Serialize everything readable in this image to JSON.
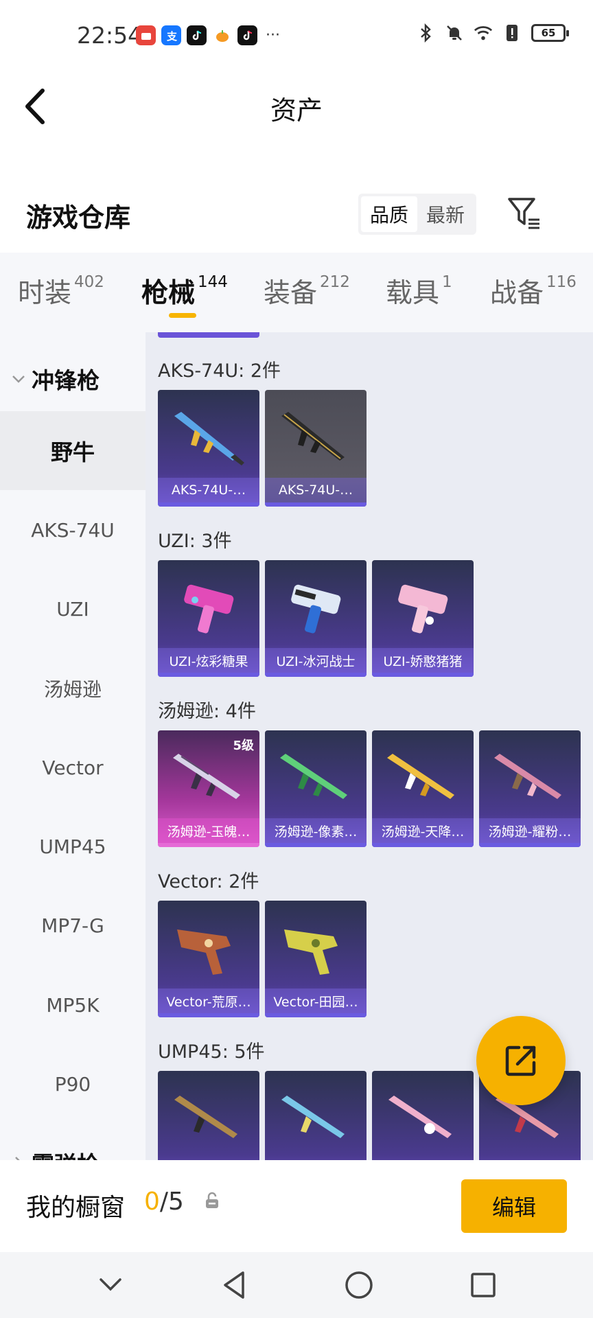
{
  "status_bar": {
    "time": "22:54",
    "battery": "65",
    "app_icons": [
      "huawei-mall-icon",
      "alipay-icon",
      "douyin-icon",
      "pumpkin-app-icon",
      "douyin-icon"
    ],
    "overflow": "···"
  },
  "header": {
    "title": "资产"
  },
  "warehouse": {
    "title": "游戏仓库",
    "sort_options": [
      "品质",
      "最新"
    ],
    "sort_selected": "品质"
  },
  "tabs": [
    {
      "label": "时装",
      "count": "402"
    },
    {
      "label": "枪械",
      "count": "144",
      "active": true
    },
    {
      "label": "装备",
      "count": "212"
    },
    {
      "label": "载具",
      "count": "1"
    },
    {
      "label": "战备",
      "count": "116"
    }
  ],
  "sidebar": {
    "group": "冲锋枪",
    "items": [
      "野牛",
      "AKS-74U",
      "UZI",
      "汤姆逊",
      "Vector",
      "UMP45",
      "MP7-G",
      "MP5K",
      "P90"
    ],
    "active_item": "野牛",
    "next_group": "霰弹枪"
  },
  "sections": [
    {
      "title": "AKS-74U: 2件",
      "cards": [
        {
          "label": "AKS-74U-…",
          "style": "purple"
        },
        {
          "label": "AKS-74U-…",
          "style": "gray"
        }
      ]
    },
    {
      "title": "UZI: 3件",
      "cards": [
        {
          "label": "UZI-炫彩糖果",
          "style": "purple"
        },
        {
          "label": "UZI-冰河战士",
          "style": "purple"
        },
        {
          "label": "UZI-娇憨猪猪",
          "style": "purple"
        }
      ]
    },
    {
      "title": "汤姆逊: 4件",
      "cards": [
        {
          "label": "汤姆逊-玉魄…",
          "style": "pink",
          "level": "5级"
        },
        {
          "label": "汤姆逊-像素…",
          "style": "purple"
        },
        {
          "label": "汤姆逊-天降…",
          "style": "purple"
        },
        {
          "label": "汤姆逊-耀粉…",
          "style": "purple"
        }
      ]
    },
    {
      "title": "Vector: 2件",
      "cards": [
        {
          "label": "Vector-荒原…",
          "style": "purple"
        },
        {
          "label": "Vector-田园…",
          "style": "purple"
        }
      ]
    },
    {
      "title": "UMP45: 5件",
      "cards": [
        {
          "label": "",
          "style": "purple"
        },
        {
          "label": "",
          "style": "purple"
        },
        {
          "label": "",
          "style": "purple"
        },
        {
          "label": "",
          "style": "purple"
        }
      ]
    }
  ],
  "bottom": {
    "showcase_label": "我的橱窗",
    "count_current": "0",
    "count_max": "/5",
    "edit_label": "编辑"
  },
  "colors": {
    "accent": "#f6b100",
    "card_purple": "#4a3a8e",
    "card_pink": "#e05ed0"
  }
}
